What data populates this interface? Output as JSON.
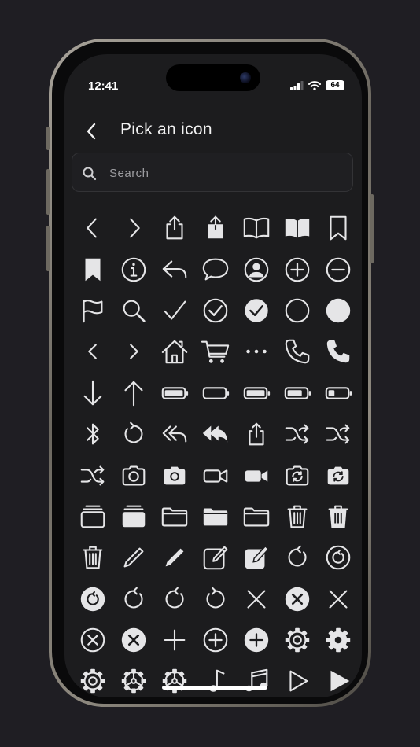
{
  "status": {
    "time": "12:41",
    "battery": "64"
  },
  "header": {
    "title": "Pick an icon"
  },
  "search": {
    "placeholder": "Search",
    "value": ""
  },
  "icons": [
    "chevron-left",
    "chevron-right",
    "share",
    "share-fill",
    "book",
    "book-fill",
    "bookmark",
    "bookmark-fill",
    "info-circle",
    "reply",
    "chat-bubble",
    "person-circle",
    "plus-circle",
    "minus-circle",
    "flag",
    "search",
    "checkmark",
    "check-circle",
    "check-circle-fill",
    "circle",
    "circle-fill",
    "chevron-left-small",
    "chevron-right-small",
    "house",
    "cart",
    "ellipsis",
    "phone",
    "phone-fill",
    "arrow-down",
    "arrow-up",
    "battery-full",
    "battery-empty",
    "battery-full-alt",
    "battery-75",
    "battery-25",
    "bluetooth",
    "rotate-left",
    "reply-all",
    "reply-all-fill",
    "share-small",
    "shuffle",
    "shuffle-alt",
    "shuffle-small",
    "camera",
    "camera-fill",
    "video",
    "video-fill",
    "camera-rotate",
    "camera-rotate-fill",
    "albums",
    "albums-fill",
    "folder",
    "folder-fill",
    "folder-alt",
    "trash",
    "trash-fill",
    "trash-alt",
    "pencil",
    "pencil-fill",
    "compose",
    "compose-fill",
    "rotate-right",
    "rotate-right-circle",
    "rotate-right-circle-fill",
    "arrow-clockwise",
    "arrow-clockwise-alt",
    "arrow-counterclockwise",
    "xmark",
    "xmark-circle-fill",
    "xmark-alt",
    "xmark-circle",
    "xmark-circle-fill-alt",
    "plus",
    "plus-circle-alt",
    "plus-circle-fill",
    "gear",
    "gear-fill",
    "gear-alt",
    "gearshape",
    "gearshape-alt",
    "music-note",
    "music-notes",
    "play",
    "play-fill"
  ],
  "colors": {
    "background": "#1c1c1e",
    "icon": "#e5e5e7"
  }
}
